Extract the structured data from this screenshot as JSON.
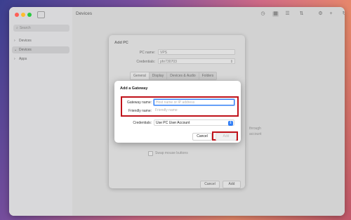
{
  "window": {
    "title": "Devices",
    "traffic_lights": [
      "#fe5f57",
      "#febc2e",
      "#28c840"
    ]
  },
  "sidebar": {
    "search_placeholder": "Search",
    "items": [
      {
        "label": "Devices",
        "selected": false
      },
      {
        "label": "Devices",
        "selected": true
      },
      {
        "label": "Apps",
        "selected": false
      }
    ]
  },
  "toolbar": {
    "icons": [
      "clock-icon",
      "grid-view-icon",
      "list-view-icon",
      "sort-icon",
      "settings-icon",
      "add-icon",
      "refresh-icon"
    ]
  },
  "add_pc": {
    "title": "Add PC",
    "pc_name_label": "PC name:",
    "pc_name_value": "VPS",
    "credentials_label": "Credentials:",
    "credentials_value": "phr730703",
    "tabs": [
      "General",
      "Display",
      "Devices & Audio",
      "Folders"
    ],
    "selected_tab": "General",
    "bg_text_through": "through",
    "bg_text_account": "account",
    "swap_mouse_label": "Swap mouse buttons",
    "cancel_label": "Cancel",
    "add_label": "Add"
  },
  "add_gateway": {
    "title": "Add a Gateway",
    "gateway_name_label": "Gateway name:",
    "gateway_name_placeholder": "Host name or IP address",
    "friendly_name_label": "Friendly name:",
    "friendly_name_placeholder": "Friendly name",
    "credentials_label": "Credentials:",
    "credentials_value": "Use PC User Account",
    "cancel_label": "Cancel",
    "add_label": "Add",
    "accent_color": "#2f7df6",
    "highlight_color": "#c0121a"
  }
}
